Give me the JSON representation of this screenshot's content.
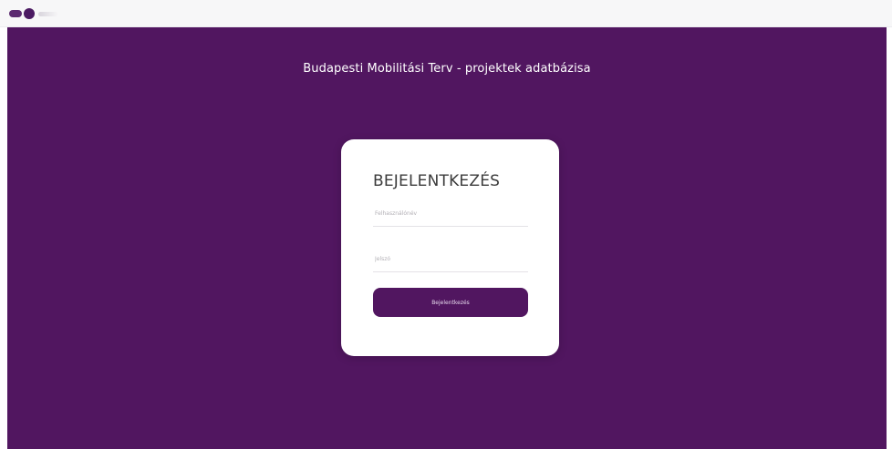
{
  "header": {
    "logo_icon": "brand-logo-icon"
  },
  "page": {
    "title": "Budapesti Mobilitási Terv - projektek adatbázisa"
  },
  "login": {
    "title": "BEJELENTKEZÉS",
    "username_placeholder": "Felhasználónév",
    "password_placeholder": "Jelszó",
    "submit_label": "Bejelentkezés"
  },
  "colors": {
    "brand_purple": "#511660",
    "card_background": "#ffffff",
    "top_bar": "#f7f7f8"
  }
}
